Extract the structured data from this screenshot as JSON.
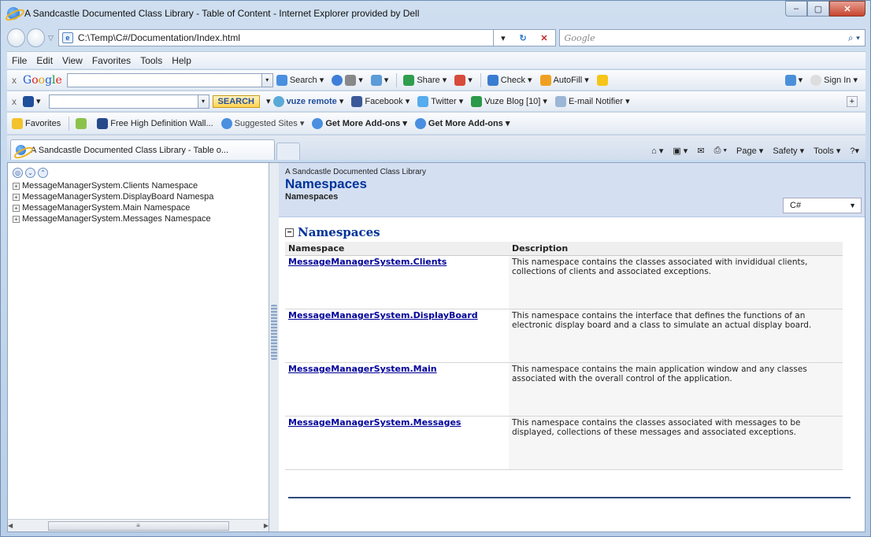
{
  "window": {
    "title": "A Sandcastle Documented Class Library - Table of Content - Internet Explorer provided by Dell"
  },
  "address": {
    "url": "C:\\Temp\\C#/Documentation/Index.html",
    "search_placeholder": "Google"
  },
  "menu": [
    "File",
    "Edit",
    "View",
    "Favorites",
    "Tools",
    "Help"
  ],
  "google_toolbar": {
    "items": [
      "Search",
      "Share",
      "Check",
      "AutoFill",
      "Sign In"
    ]
  },
  "vuze_toolbar": {
    "search_label": "SEARCH",
    "items": [
      "vuze remote",
      "Facebook",
      "Twitter",
      "Vuze Blog [10]",
      "E-mail Notifier"
    ]
  },
  "favorites_bar": {
    "favorites_label": "Favorites",
    "items": [
      "Free High Definition Wall...",
      "Suggested Sites ▾",
      "Get More Add-ons ▾",
      "Get More Add-ons ▾"
    ]
  },
  "tab": {
    "label": "A Sandcastle Documented Class Library - Table o..."
  },
  "command_bar": [
    "Page ▾",
    "Safety ▾",
    "Tools ▾"
  ],
  "tree": {
    "nodes": [
      {
        "toggle": "+",
        "label": "MessageManagerSystem.Clients Namespace"
      },
      {
        "toggle": "+",
        "label": "MessageManagerSystem.DisplayBoard Namespa"
      },
      {
        "toggle": "+",
        "label": "MessageManagerSystem.Main Namespace"
      },
      {
        "toggle": "+",
        "label": "MessageManagerSystem.Messages Namespace"
      }
    ]
  },
  "doc": {
    "library": "A Sandcastle Documented Class Library",
    "title": "Namespaces",
    "subtitle": "Namespaces",
    "language": "C#",
    "section_title": "Namespaces",
    "columns": [
      "Namespace",
      "Description"
    ],
    "rows": [
      {
        "name": "MessageManagerSystem.Clients",
        "desc": "This namespace contains the classes associated with invididual clients, collections of clients and associated exceptions."
      },
      {
        "name": "MessageManagerSystem.DisplayBoard",
        "desc": "This namespace contains the interface that defines the functions of an electronic display board and a class to simulate an actual display board."
      },
      {
        "name": "MessageManagerSystem.Main",
        "desc": "This namespace contains the main application window and any classes associated with the overall control of the application."
      },
      {
        "name": "MessageManagerSystem.Messages",
        "desc": "This namespace contains the classes associated with messages to be displayed, collections of these messages and associated exceptions."
      }
    ]
  }
}
